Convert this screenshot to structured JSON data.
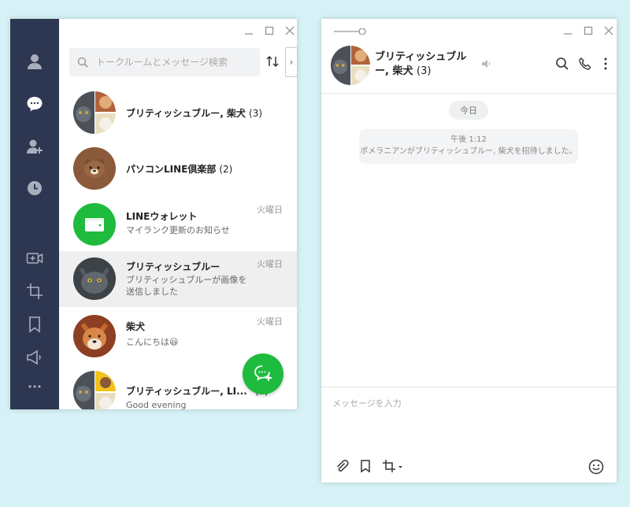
{
  "list_window": {
    "search_placeholder": "トークルームとメッセージ検索",
    "collapse_glyph": "›",
    "sidebar_items": [
      "friends-icon",
      "chats-icon",
      "add-friend-icon",
      "history-icon",
      "video-call-icon",
      "screenshot-icon",
      "keep-icon",
      "announcement-icon",
      "more-icon"
    ],
    "chats": [
      {
        "name": "ブリティッシュブルー, 柴犬",
        "count": "(3)",
        "preview": "",
        "date": ""
      },
      {
        "name": "パソコンLINE倶楽部",
        "count": "(2)",
        "preview": "",
        "date": ""
      },
      {
        "name": "LINEウォレット",
        "count": "",
        "preview": "マイランク更新のお知らせ",
        "date": "火曜日"
      },
      {
        "name": "ブリティッシュブルー",
        "count": "",
        "preview": "ブリティッシュブルーが画像を送信しました",
        "date": "火曜日"
      },
      {
        "name": "柴犬",
        "count": "",
        "preview": "こんにちは😃",
        "date": "火曜日"
      },
      {
        "name": "ブリティッシュブルー, LI...",
        "count": "(3)",
        "preview": "Good evening",
        "date": ""
      }
    ]
  },
  "chat_window": {
    "title": "ブリティッシュブルー, 柴犬",
    "member_count": "(3)",
    "date_label": "今日",
    "system_message": {
      "time": "午後 1:12",
      "text": "ポメラニアンがブリティッシュブルー, 柴犬を招待しました。"
    },
    "composer_placeholder": "メッセージを入力"
  },
  "colors": {
    "sidebar": "#2e3751",
    "accent_green": "#1fbb3f",
    "background": "#d6f2f6"
  }
}
